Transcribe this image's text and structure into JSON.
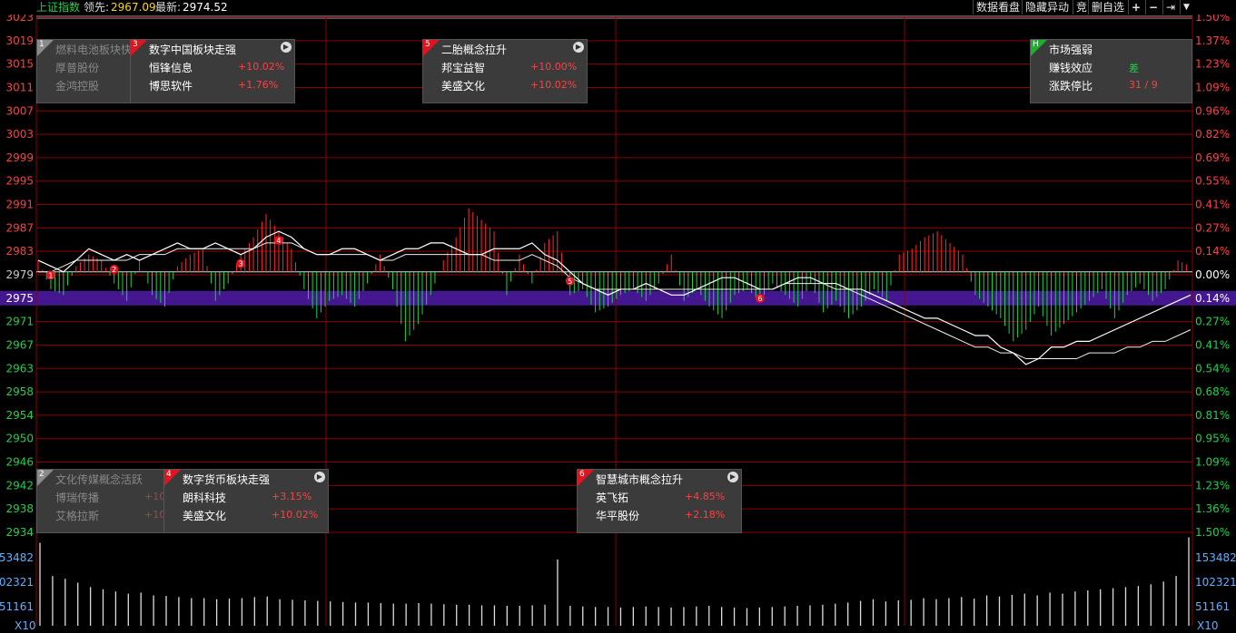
{
  "topbar": {
    "index_name": "上证指数",
    "lead_label": "领先:",
    "lead_value": "2967.09",
    "latest_label": "最新:",
    "latest_value": "2974.52",
    "buttons": [
      "数据看盘",
      "隐藏异动",
      "竞",
      "删自选"
    ],
    "icons": [
      "plus-icon",
      "minus-icon",
      "pin-icon",
      "dropdown-icon"
    ]
  },
  "colors": {
    "up": "#ff2a2a",
    "down": "#1fd24a",
    "price": "#ffffff",
    "grid": "#8b0000",
    "highlight": "#4a1aa0"
  },
  "chart_data": {
    "type": "line",
    "y_axis_left": [
      "3023",
      "3019",
      "3015",
      "3011",
      "3007",
      "3003",
      "2999",
      "2995",
      "2991",
      "2987",
      "2983",
      "2979",
      "2975",
      "2971",
      "2967",
      "2963",
      "2958",
      "2954",
      "2950",
      "2946",
      "2942",
      "2938",
      "2934"
    ],
    "y_axis_right": [
      "1.50%",
      "1.37%",
      "1.23%",
      "1.09%",
      "0.96%",
      "0.82%",
      "0.69%",
      "0.55%",
      "0.41%",
      "0.27%",
      "0.14%",
      "0.00%",
      "0.14%",
      "0.27%",
      "0.41%",
      "0.54%",
      "0.68%",
      "0.81%",
      "0.95%",
      "1.09%",
      "1.23%",
      "1.36%",
      "1.50%"
    ],
    "y_range": [
      2934,
      3023
    ],
    "prev_close": 2979,
    "highlight_label": "2975",
    "highlight_right": "0.14%",
    "volume_axis": [
      "153482",
      "102321",
      "51161"
    ],
    "volume_unit": "X10",
    "price": [
      2981,
      2980,
      2979,
      2981,
      2983,
      2982,
      2981,
      2982,
      2981,
      2982,
      2983,
      2984,
      2983,
      2983,
      2984,
      2983,
      2982,
      2983,
      2985,
      2986,
      2985,
      2983,
      2982,
      2982,
      2983,
      2983,
      2982,
      2981,
      2982,
      2983,
      2983,
      2984,
      2984,
      2983,
      2982,
      2982,
      2983,
      2983,
      2983,
      2984,
      2982,
      2981,
      2979,
      2977,
      2976,
      2975,
      2976,
      2976,
      2977,
      2976,
      2975,
      2975,
      2976,
      2977,
      2978,
      2978,
      2977,
      2976,
      2976,
      2977,
      2978,
      2978,
      2977,
      2977,
      2976,
      2976,
      2975,
      2974,
      2973,
      2972,
      2971,
      2971,
      2970,
      2969,
      2968,
      2968,
      2966,
      2965,
      2963,
      2964,
      2966,
      2966,
      2967,
      2967,
      2968,
      2969,
      2970,
      2971,
      2972,
      2973,
      2974,
      2975
    ],
    "average": [
      2979,
      2979,
      2980,
      2981,
      2981,
      2981,
      2981,
      2981,
      2982,
      2982,
      2982,
      2983,
      2983,
      2983,
      2983,
      2983,
      2983,
      2983,
      2984,
      2984,
      2984,
      2983,
      2982,
      2982,
      2982,
      2982,
      2982,
      2981,
      2981,
      2982,
      2982,
      2982,
      2982,
      2982,
      2982,
      2982,
      2981,
      2981,
      2981,
      2982,
      2981,
      2980,
      2978,
      2977,
      2976,
      2976,
      2976,
      2976,
      2976,
      2976,
      2976,
      2976,
      2976,
      2976,
      2976,
      2976,
      2976,
      2976,
      2976,
      2977,
      2977,
      2977,
      2977,
      2976,
      2976,
      2975,
      2974,
      2973,
      2972,
      2971,
      2970,
      2969,
      2968,
      2967,
      2966,
      2966,
      2965,
      2965,
      2964,
      2964,
      2964,
      2964,
      2964,
      2965,
      2965,
      2965,
      2966,
      2966,
      2967,
      2967,
      2968,
      2969
    ],
    "breadth": [
      2,
      -3,
      -4,
      1,
      3,
      2,
      -2,
      -5,
      2,
      -4,
      -6,
      1,
      3,
      4,
      -5,
      -2,
      3,
      6,
      10,
      7,
      4,
      -3,
      -8,
      -5,
      -4,
      -6,
      -2,
      3,
      -3,
      -12,
      -9,
      -4,
      2,
      6,
      11,
      9,
      7,
      -4,
      3,
      -2,
      5,
      7,
      -4,
      -3,
      -7,
      -6,
      -4,
      -3,
      -5,
      -2,
      3,
      -5,
      -3,
      -6,
      -8,
      -4,
      -3,
      -5,
      -2,
      -4,
      -6,
      -2,
      -7,
      -5,
      -8,
      -6,
      -3,
      -5,
      3,
      4,
      6,
      7,
      5,
      3,
      -4,
      -6,
      -8,
      -12,
      -10,
      -6,
      -11,
      -9,
      -7,
      -5,
      -3,
      -8,
      -4,
      -2,
      -5,
      -3,
      2,
      1
    ],
    "volume": [
      150000,
      90000,
      85000,
      78000,
      70000,
      66000,
      62000,
      58000,
      60000,
      55000,
      54000,
      52000,
      50000,
      50000,
      48000,
      49000,
      50000,
      52000,
      53000,
      48000,
      47000,
      46000,
      45000,
      44000,
      43000,
      42000,
      42000,
      41000,
      40000,
      40000,
      41000,
      40000,
      39000,
      38000,
      38000,
      37000,
      37000,
      36000,
      36000,
      37000,
      38000,
      120000,
      36000,
      35000,
      34000,
      34000,
      33000,
      34000,
      35000,
      34000,
      33000,
      34000,
      35000,
      36000,
      34000,
      33000,
      32000,
      33000,
      34000,
      35000,
      36000,
      37000,
      38000,
      40000,
      42000,
      45000,
      48000,
      44000,
      46000,
      47000,
      50000,
      48000,
      50000,
      52000,
      49000,
      55000,
      53000,
      56000,
      58000,
      55000,
      60000,
      58000,
      62000,
      64000,
      66000,
      68000,
      70000,
      72000,
      75000,
      80000,
      90000,
      160000
    ],
    "events": [
      {
        "label": "1",
        "series": "red"
      },
      {
        "label": "2",
        "series": "red"
      },
      {
        "label": "3",
        "series": "red"
      },
      {
        "label": "4",
        "series": "red"
      },
      {
        "label": "5",
        "series": "red"
      },
      {
        "label": "6",
        "series": "red"
      }
    ]
  },
  "popups": [
    {
      "num": "1",
      "title": "燃料电池板块快",
      "rows": [
        {
          "name": "厚普股份",
          "pct": ""
        },
        {
          "name": "金鸿控股",
          "pct": ""
        }
      ],
      "style": "gray",
      "dim": true
    },
    {
      "num": "3",
      "title": "数字中国板块走强",
      "rows": [
        {
          "name": "恒锋信息",
          "pct": "+10.02%"
        },
        {
          "name": "博思软件",
          "pct": "+1.76%"
        }
      ],
      "style": "red",
      "dim": false
    },
    {
      "num": "5",
      "title": "二胎概念拉升",
      "rows": [
        {
          "name": "邦宝益智",
          "pct": "+10.00%"
        },
        {
          "name": "美盛文化",
          "pct": "+10.02%"
        }
      ],
      "style": "red",
      "dim": false
    },
    {
      "num": "H",
      "title": "市场强弱",
      "rows": [
        {
          "name": "赚钱效应",
          "pct": "差"
        },
        {
          "name": "涨跌停比",
          "pct": "31 / 9"
        }
      ],
      "style": "green",
      "dim": false
    },
    {
      "num": "2",
      "title": "文化传媒概念活跃",
      "rows": [
        {
          "name": "博瑞传播",
          "pct": "+10."
        },
        {
          "name": "艾格拉斯",
          "pct": "+10."
        }
      ],
      "style": "gray",
      "dim": true
    },
    {
      "num": "4",
      "title": "数字货币板块走强",
      "rows": [
        {
          "name": "朗科科技",
          "pct": "+3.15%"
        },
        {
          "name": "美盛文化",
          "pct": "+10.02%"
        }
      ],
      "style": "red",
      "dim": false
    },
    {
      "num": "6",
      "title": "智慧城市概念拉升",
      "rows": [
        {
          "name": "英飞拓",
          "pct": "+4.85%"
        },
        {
          "name": "华平股份",
          "pct": "+2.18%"
        }
      ],
      "style": "red",
      "dim": false
    }
  ]
}
